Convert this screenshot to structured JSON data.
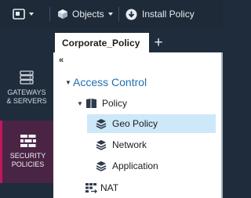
{
  "toolbar": {
    "objects_label": "Objects",
    "install_policy_label": "Install Policy"
  },
  "nav": {
    "gateways_label": "GATEWAYS\n& SERVERS",
    "security_label": "SECURITY\nPOLICIES"
  },
  "tabs": {
    "active_label": "Corporate_Policy",
    "add_label": "+"
  },
  "tree": {
    "collapse_glyph": "«",
    "access_control": "Access Control",
    "policy": "Policy",
    "geo_policy": "Geo Policy",
    "network": "Network",
    "application": "Application",
    "nat": "NAT",
    "selected_item": "Geo Policy"
  },
  "colors": {
    "toolbar_bg": "#1e2a38",
    "active_nav_bg": "#4a2444",
    "active_nav_accent": "#c2185b",
    "selection_bg": "#cde8f9",
    "link_blue": "#1f6fb2"
  },
  "icons": {
    "app_menu": "app-menu-icon",
    "objects": "cube-icon",
    "install_policy": "download-circle-icon",
    "gateways": "server-stack-icon",
    "security": "brick-wall-icon",
    "policy": "book-icon",
    "layer": "layers-icon",
    "nat": "nat-grid-icon"
  }
}
